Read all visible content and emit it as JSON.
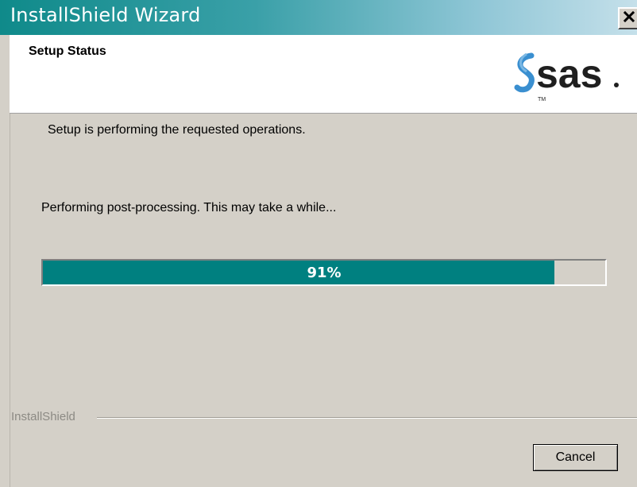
{
  "window": {
    "title": "InstallShield Wizard",
    "close_icon": "close-icon"
  },
  "header": {
    "title": "Setup Status",
    "logo_text": "sas",
    "logo_trademark": "TM"
  },
  "main": {
    "status_text": "Setup is performing the requested operations.",
    "detail_text": "Performing post-processing. This may take a while...",
    "progress": {
      "percent": 91,
      "label": "91%"
    }
  },
  "footer": {
    "group_label": "InstallShield",
    "cancel_label": "Cancel"
  },
  "colors": {
    "titlebar_start": "#0f8a8a",
    "titlebar_end": "#c5e0ea",
    "progress_fill": "#008080",
    "dialog_face": "#d4d0c8",
    "logo_accent": "#3a8fd0"
  }
}
